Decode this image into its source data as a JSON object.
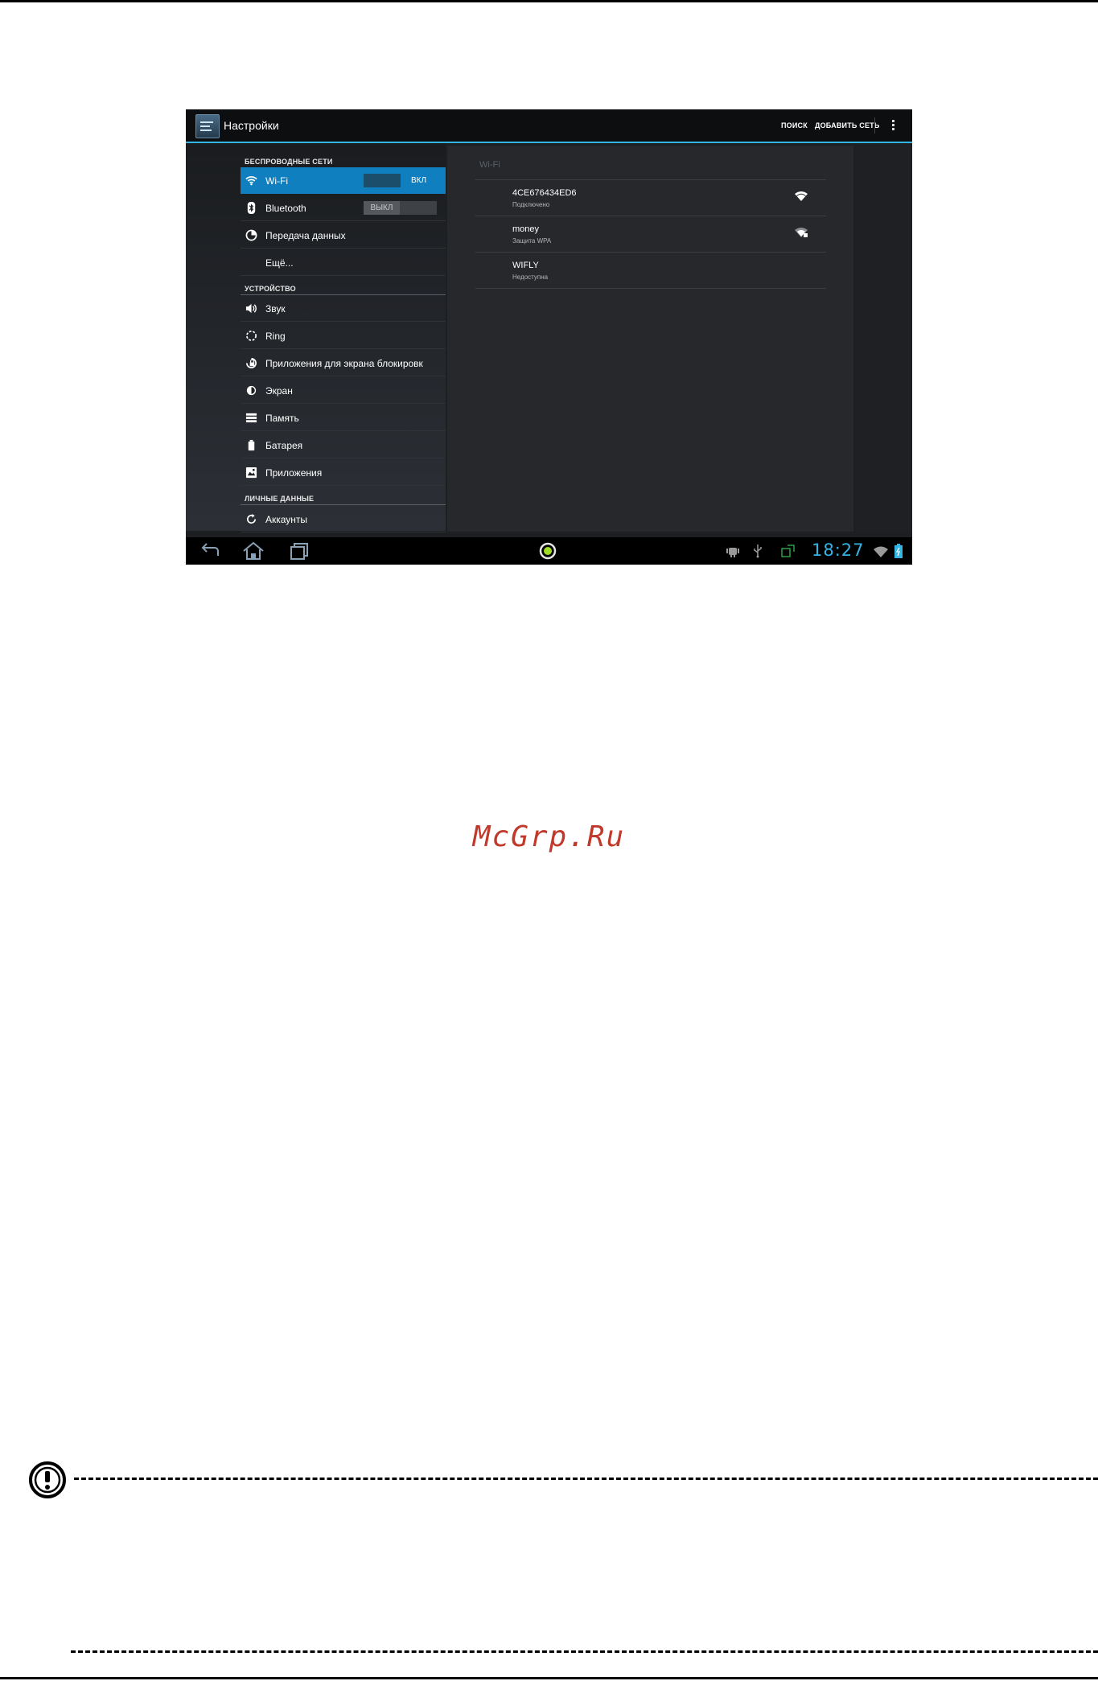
{
  "app": {
    "title": "Настройки"
  },
  "actionbar": {
    "search_label": "ПОИСК",
    "add_network_label": "ДОБАВИТЬ СЕТЬ"
  },
  "settings": {
    "wireless_header": "БЕСПРОВОДНЫЕ СЕТИ",
    "device_header": "УСТРОЙСТВО",
    "personal_header": "ЛИЧНЫЕ ДАННЫЕ",
    "items": [
      {
        "label": "Wi-Fi",
        "icon": "wifi-icon",
        "toggle": "ВКЛ",
        "toggle_state": "on"
      },
      {
        "label": "Bluetooth",
        "icon": "bluetooth-icon",
        "toggle": "ВЫКЛ",
        "toggle_state": "off"
      },
      {
        "label": "Передача данных",
        "icon": "data-usage-icon"
      },
      {
        "label": "Ещё...",
        "icon": ""
      },
      {
        "label": "Звук",
        "icon": "volume-icon"
      },
      {
        "label": "Ring",
        "icon": "ring-icon"
      },
      {
        "label": "Приложения для экрана блокировк",
        "icon": "lock-screen-icon"
      },
      {
        "label": "Экран",
        "icon": "brightness-icon"
      },
      {
        "label": "Память",
        "icon": "storage-icon"
      },
      {
        "label": "Батарея",
        "icon": "battery-icon"
      },
      {
        "label": "Приложения",
        "icon": "apps-icon"
      },
      {
        "label": "Аккаунты",
        "icon": "sync-icon"
      }
    ]
  },
  "wifi_pane": {
    "title": "Wi-Fi",
    "networks": [
      {
        "ssid": "4CE676434ED6",
        "status": "Подключено",
        "icon": "wifi-signal-icon"
      },
      {
        "ssid": "money",
        "status": "Защита WPA",
        "icon": "wifi-locked-icon"
      },
      {
        "ssid": "WIFLY",
        "status": "Недоступна",
        "icon": ""
      }
    ]
  },
  "statusbar": {
    "time": "18:27"
  },
  "watermark": "McGrp.Ru",
  "colors": {
    "accent": "#33b5e5",
    "selected": "#0f7fbf",
    "watermark": "#c0392b"
  }
}
